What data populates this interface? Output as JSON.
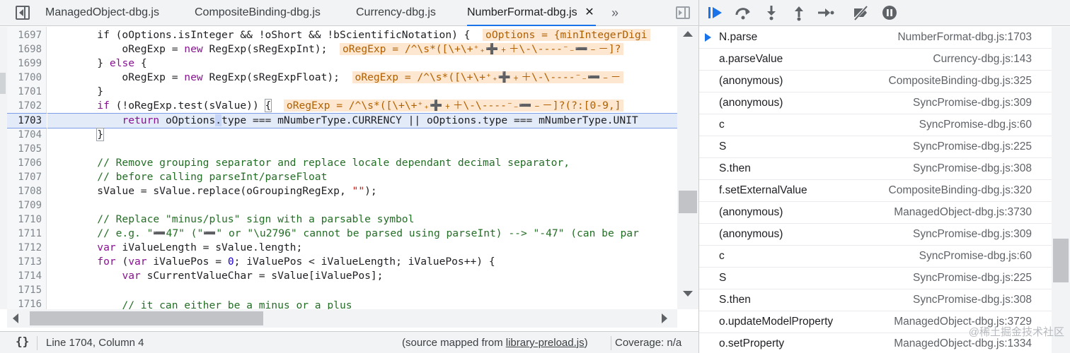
{
  "tabs": [
    {
      "label": "ManagedObject-dbg.js"
    },
    {
      "label": "CompositeBinding-dbg.js"
    },
    {
      "label": "Currency-dbg.js"
    },
    {
      "label": "NumberFormat-dbg.js",
      "active": true,
      "close": "✕"
    }
  ],
  "more_tabs": "»",
  "line_numbers": [
    "1697",
    "1698",
    "1699",
    "1700",
    "1701",
    "1702",
    "1703",
    "1704",
    "1705",
    "1706",
    "1707",
    "1708",
    "1709",
    "1710",
    "1711",
    "1712",
    "1713",
    "1714",
    "1715",
    "1716"
  ],
  "code": {
    "l1697_a": "        if (oOptions.isInteger && !oShort && !bScientificNotation) {",
    "l1697_inline": "oOptions = {minIntegerDigi",
    "l1698_a": "            oRegExp = ",
    "l1698_kw": "new",
    "l1698_b": " RegExp(sRegExpInt);",
    "l1698_inline": "oRegExp = /^\\s*([\\+\\+⁺₊➕﹢＋\\-\\----⁻₋➖﹣－]?",
    "l1699_a": "        } ",
    "l1699_kw": "else",
    "l1699_b": " {",
    "l1700_a": "            oRegExp = ",
    "l1700_kw": "new",
    "l1700_b": " RegExp(sRegExpFloat);",
    "l1700_inline": "oRegExp = /^\\s*([\\+\\+⁺₊➕﹢＋\\-\\----⁻₋➖﹣－",
    "l1701": "        }",
    "l1702_kw": "if",
    "l1702_b": " (!oRegExp.test(sValue)) ",
    "l1702_brace": "{",
    "l1702_inline": "oRegExp = /^\\s*([\\+\\+⁺₊➕﹢＋\\-\\----⁻₋➖﹣－]?(?:[0-9,]",
    "l1703_kw": "return",
    "l1703_a": " oOptions",
    "l1703_caret": ".",
    "l1703_b": "type === mNumberType.CURRENCY || oOptions.type === mNumberType.UNIT",
    "l1704_brace": "}",
    "l1706": "        // Remove grouping separator and replace locale dependant decimal separator,",
    "l1707": "        // before calling parseInt/parseFloat",
    "l1708_a": "        sValue = sValue.replace(oGroupingRegExp, ",
    "l1708_str": "\"\"",
    "l1708_b": ");",
    "l1710": "        // Replace \"minus/plus\" sign with a parsable symbol",
    "l1711": "        // e.g. \"➖47\" (\"➖\" or \"\\u2796\" cannot be parsed using parseInt) --> \"-47\" (can be par",
    "l1712_kw": "var",
    "l1712_b": " iValueLength = sValue.length;",
    "l1713_kw": "for",
    "l1713_a": " (",
    "l1713_kw2": "var",
    "l1713_b": " iValuePos = ",
    "l1713_num": "0",
    "l1713_c": "; iValuePos < iValueLength; iValuePos++) {",
    "l1714_kw": "var",
    "l1714_b": " sCurrentValueChar = sValue[iValuePos];",
    "l1716": "            // it can either be a minus or a plus"
  },
  "status": {
    "pretty_print": "{}",
    "position": "Line 1704, Column 4",
    "source_mapped_prefix": "(source mapped from ",
    "source_mapped_link": "library-preload.js",
    "source_mapped_suffix": ")",
    "coverage": "Coverage: n/a"
  },
  "call_stack": [
    {
      "fn": "N.parse",
      "loc": "NumberFormat-dbg.js:1703",
      "current": true
    },
    {
      "fn": "a.parseValue",
      "loc": "Currency-dbg.js:143"
    },
    {
      "fn": "(anonymous)",
      "loc": "CompositeBinding-dbg.js:325"
    },
    {
      "fn": "(anonymous)",
      "loc": "SyncPromise-dbg.js:309"
    },
    {
      "fn": "c",
      "loc": "SyncPromise-dbg.js:60"
    },
    {
      "fn": "S",
      "loc": "SyncPromise-dbg.js:225"
    },
    {
      "fn": "S.then",
      "loc": "SyncPromise-dbg.js:308"
    },
    {
      "fn": "f.setExternalValue",
      "loc": "CompositeBinding-dbg.js:320"
    },
    {
      "fn": "(anonymous)",
      "loc": "ManagedObject-dbg.js:3730"
    },
    {
      "fn": "(anonymous)",
      "loc": "SyncPromise-dbg.js:309"
    },
    {
      "fn": "c",
      "loc": "SyncPromise-dbg.js:60"
    },
    {
      "fn": "S",
      "loc": "SyncPromise-dbg.js:225"
    },
    {
      "fn": "S.then",
      "loc": "SyncPromise-dbg.js:308"
    },
    {
      "fn": "o.updateModelProperty",
      "loc": "ManagedObject-dbg.js:3729"
    },
    {
      "fn": "o.setProperty",
      "loc": "ManagedObject-dbg.js:1334"
    }
  ],
  "watermark": "@稀土掘金技术社区",
  "colors": {
    "accent": "#1a73e8",
    "inline_value_bg": "#fde7d0",
    "exec_line_bg": "#e3eaf8"
  },
  "icons": [
    "navigator-toggle-icon",
    "chevron-double-right-icon",
    "debugger-toggle-icon",
    "resume-icon",
    "step-over-icon",
    "step-into-icon",
    "step-out-icon",
    "step-icon",
    "deactivate-breakpoints-icon",
    "pause-on-exceptions-icon"
  ]
}
